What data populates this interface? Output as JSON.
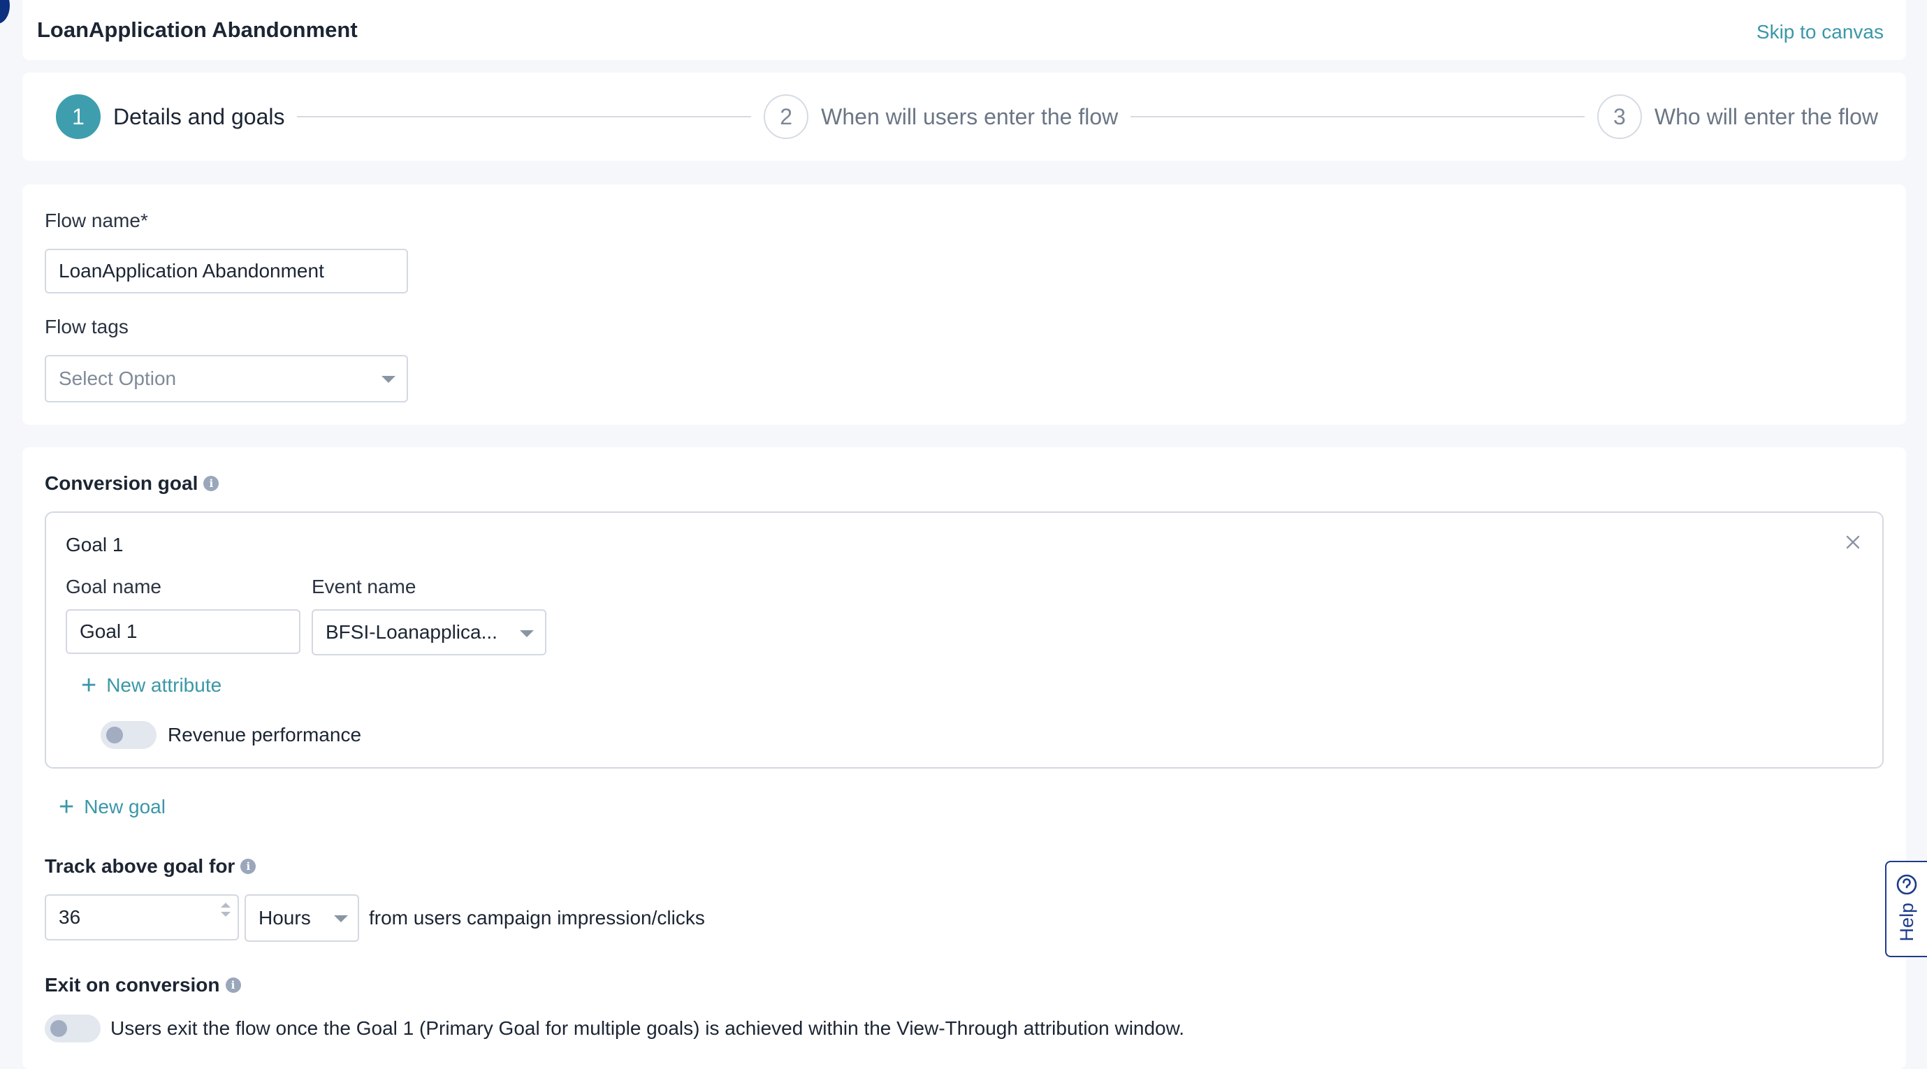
{
  "header": {
    "title": "LoanApplication Abandonment",
    "skip_label": "Skip to canvas"
  },
  "stepper": {
    "steps": [
      {
        "num": "1",
        "label": "Details and goals"
      },
      {
        "num": "2",
        "label": "When will users enter the flow"
      },
      {
        "num": "3",
        "label": "Who will enter the flow"
      }
    ],
    "active_step": 1
  },
  "details": {
    "flow_name_label": "Flow name*",
    "flow_name_value": "LoanApplication Abandonment",
    "flow_tags_label": "Flow tags",
    "flow_tags_placeholder": "Select Option"
  },
  "conversion": {
    "title": "Conversion goal",
    "goal": {
      "title": "Goal 1",
      "goal_name_label": "Goal name",
      "goal_name_value": "Goal 1",
      "event_name_label": "Event name",
      "event_name_value": "BFSI-Loanapplica...",
      "new_attribute_label": "New attribute",
      "revenue_label": "Revenue performance",
      "revenue_enabled": false
    },
    "new_goal_label": "New goal",
    "track_title": "Track above goal for",
    "track_value": "36",
    "track_unit": "Hours",
    "track_suffix": "from users campaign impression/clicks",
    "exit_title": "Exit on conversion",
    "exit_enabled": false,
    "exit_text": "Users exit the flow once the Goal 1 (Primary Goal for multiple goals) is achieved within the View-Through attribution window."
  },
  "help": {
    "label": "Help"
  },
  "colors": {
    "accent": "#3e9ead",
    "link": "#3b97a8",
    "help_border": "#1d3b8c"
  }
}
